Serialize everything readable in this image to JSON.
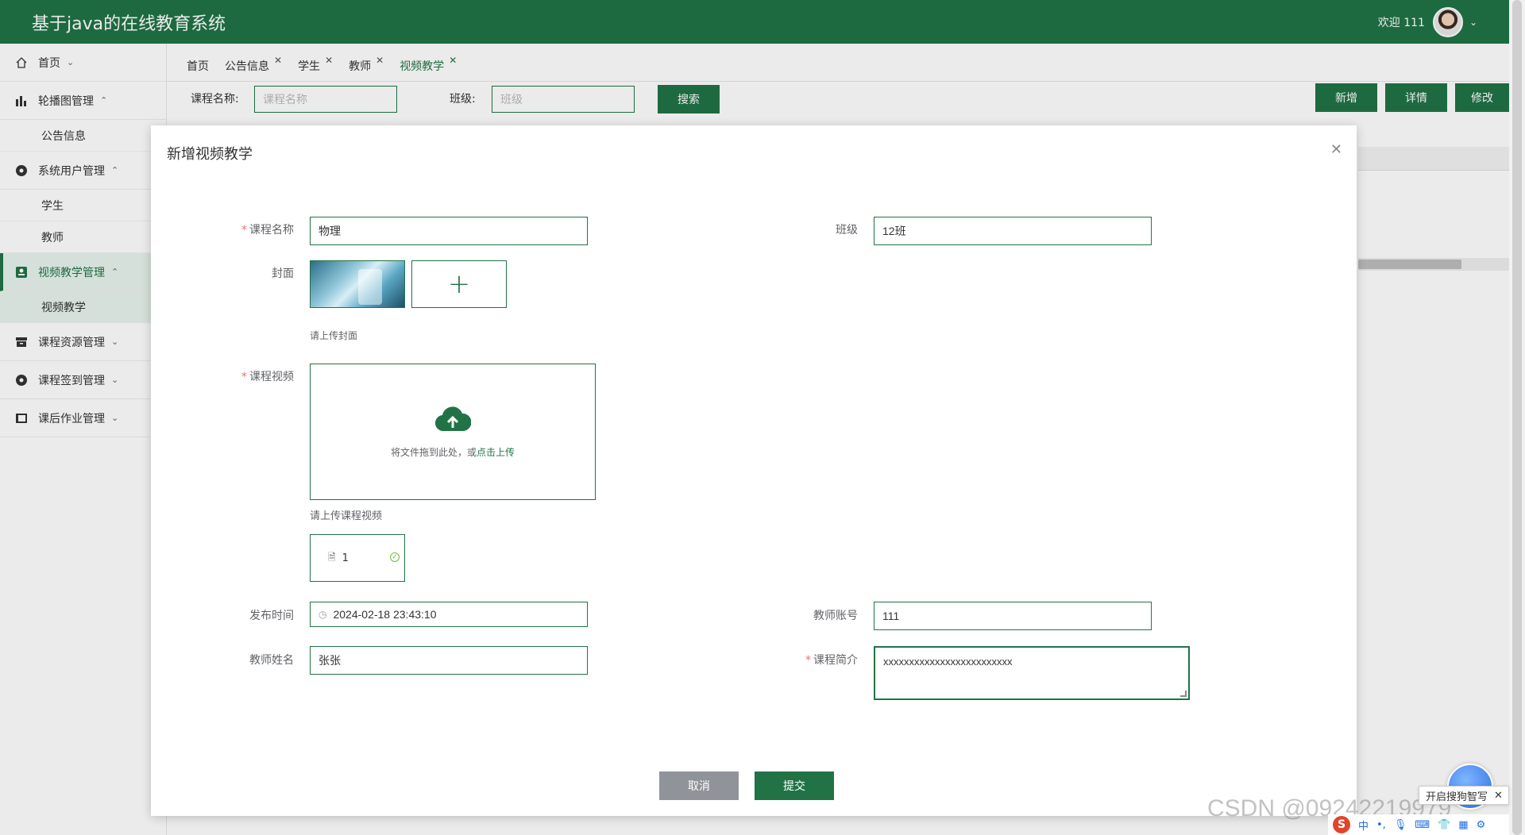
{
  "app": {
    "title": "基于java的在线教育系统",
    "welcome": "欢迎 111"
  },
  "sidebar": {
    "items": [
      {
        "label": "首页",
        "caret": "⌄",
        "icon": "home-icon"
      },
      {
        "label": "轮播图管理",
        "caret": "⌃",
        "icon": "chart-icon"
      },
      {
        "sub": "公告信息"
      },
      {
        "label": "系统用户管理",
        "caret": "⌃",
        "icon": "user-dot-icon"
      },
      {
        "sub": "学生"
      },
      {
        "sub": "教师"
      },
      {
        "label": "视频教学管理",
        "caret": "⌃",
        "icon": "video-icon"
      },
      {
        "sub": "视频教学"
      },
      {
        "label": "课程资源管理",
        "caret": "⌄",
        "icon": "box-icon"
      },
      {
        "label": "课程签到管理",
        "caret": "⌄",
        "icon": "user-dot-icon"
      },
      {
        "label": "课后作业管理",
        "caret": "⌄",
        "icon": "book-icon"
      }
    ]
  },
  "tabs": [
    {
      "label": "首页",
      "closable": false
    },
    {
      "label": "公告信息",
      "closable": true
    },
    {
      "label": "学生",
      "closable": true
    },
    {
      "label": "教师",
      "closable": true
    },
    {
      "label": "视频教学",
      "closable": true,
      "active": true
    }
  ],
  "tab_close": "✕",
  "search": {
    "course_label": "课程名称:",
    "course_placeholder": "课程名称",
    "class_label": "班级:",
    "class_placeholder": "班级",
    "search_button": "搜索",
    "add_button": "新增",
    "detail_button": "详情",
    "edit_button": "修改"
  },
  "dialog": {
    "title": "新增视频教学",
    "close": "✕",
    "fields": {
      "course_name_label": "课程名称",
      "course_name_value": "物理",
      "class_label": "班级",
      "class_value": "12班",
      "cover_label": "封面",
      "cover_hint": "请上传封面",
      "cover_add": "+",
      "video_label": "课程视频",
      "upload_text": "将文件拖到此处，或",
      "upload_link": "点击上传",
      "video_hint": "请上传课程视频",
      "file_name": "1",
      "publish_time_label": "发布时间",
      "publish_time_value": "2024-02-18 23:43:10",
      "teacher_account_label": "教师账号",
      "teacher_account_value": "111",
      "teacher_name_label": "教师姓名",
      "teacher_name_value": "张张",
      "intro_label": "课程简介",
      "intro_value": "xxxxxxxxxxxxxxxxxxxxxxxxx"
    },
    "cancel_button": "取消",
    "submit_button": "提交"
  },
  "overlay_artifacts": {
    "ime_popup": "开启搜狗智写",
    "ime_bar": [
      "中",
      "•,",
      "🎙",
      "⌨",
      "👕",
      "▦",
      "⚙"
    ],
    "ime_logo": "S",
    "watermark": "CSDN @09242219979"
  },
  "colors": {
    "primary": "#217346",
    "required": "#f56c6c"
  }
}
